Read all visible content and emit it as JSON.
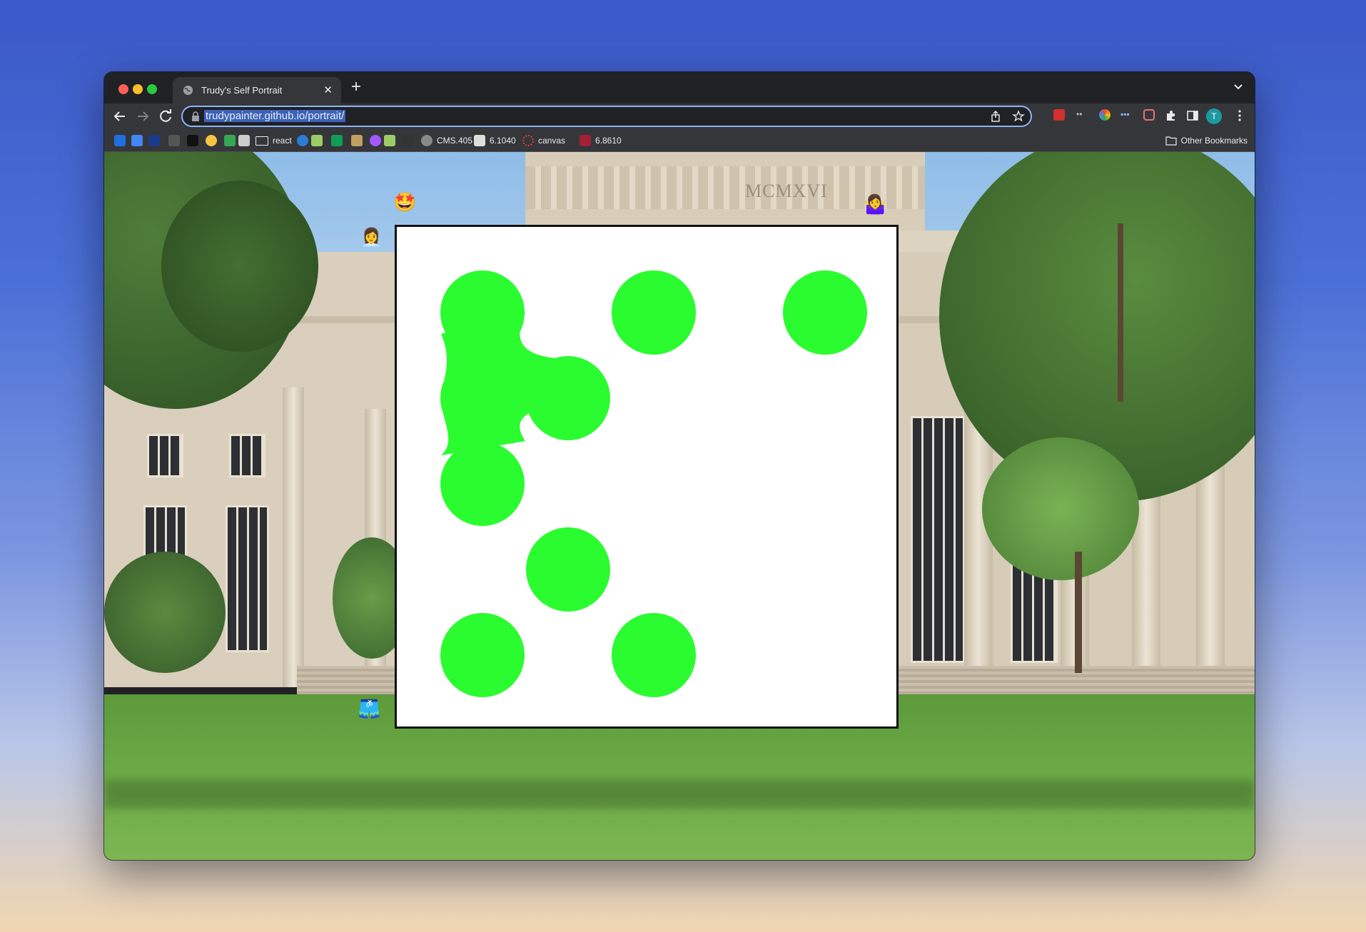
{
  "browser": {
    "tab_title": "Trudy's Self Portrait",
    "url": "trudypainter.github.io/portrait/",
    "profile_initial": "T",
    "bookmarks": [
      {
        "label": "",
        "icon": "dropbox-icon"
      },
      {
        "label": "",
        "icon": "calendar-icon"
      },
      {
        "label": "",
        "icon": "nw-icon"
      },
      {
        "label": "",
        "icon": "stars-icon"
      },
      {
        "label": "",
        "icon": "nts-icon"
      },
      {
        "label": "",
        "icon": "smiley-icon"
      },
      {
        "label": "",
        "icon": "drive-icon"
      },
      {
        "label": "",
        "icon": "book-icon"
      },
      {
        "label": "react",
        "icon": "folder-icon"
      },
      {
        "label": "",
        "icon": "edge-icon"
      },
      {
        "label": "",
        "icon": "house-icon"
      },
      {
        "label": "",
        "icon": "sheets-icon"
      },
      {
        "label": "",
        "icon": "money-house-icon"
      },
      {
        "label": "",
        "icon": "messenger-icon"
      },
      {
        "label": "",
        "icon": "house-icon"
      },
      {
        "label": "",
        "icon": "zotero-icon"
      },
      {
        "label": "CMS.405",
        "icon": "globe-icon"
      },
      {
        "label": "6.1040",
        "icon": "page-icon"
      },
      {
        "label": "canvas",
        "icon": "canvas-icon"
      },
      {
        "label": "6.8610",
        "icon": "mit-icon"
      }
    ],
    "other_bookmarks": "Other Bookmarks"
  },
  "page": {
    "inscription": "MCMXVI",
    "emojis": {
      "star_struck": "🤩",
      "woman_technologist": "👩‍💼",
      "woman_shrugging": "🤷‍♀️",
      "shorts": "🩳"
    },
    "portrait": {
      "background": "#ffffff",
      "dot_color": "#2afc2f",
      "dots_grid_3x5": [
        [
          1,
          1,
          1
        ],
        [
          1,
          1,
          0
        ],
        [
          1,
          0,
          0
        ],
        [
          0,
          1,
          0
        ],
        [
          1,
          1,
          0
        ]
      ]
    }
  }
}
